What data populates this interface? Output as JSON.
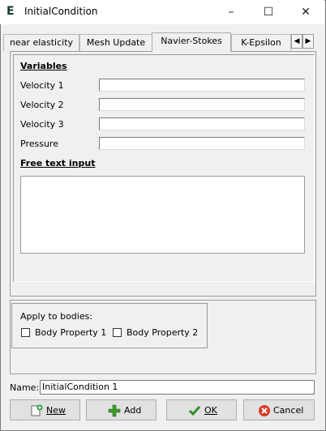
{
  "window": {
    "app_icon": "E",
    "title": "InitialCondition",
    "minimize": "–",
    "maximize": "☐",
    "close": "✕"
  },
  "tabs": [
    {
      "label": "near elasticity",
      "active": false
    },
    {
      "label": "Mesh Update",
      "active": false
    },
    {
      "label": "Navier-Stokes",
      "active": true
    },
    {
      "label": "K-Epsilon",
      "active": false
    }
  ],
  "tab_scroll": {
    "left": "◀",
    "right": "▶"
  },
  "variables": {
    "title": "Variables",
    "fields": [
      {
        "label": "Velocity 1",
        "value": ""
      },
      {
        "label": "Velocity 2",
        "value": ""
      },
      {
        "label": "Velocity 3",
        "value": ""
      },
      {
        "label": "Pressure",
        "value": ""
      }
    ]
  },
  "free_text": {
    "title": "Free text input",
    "value": ""
  },
  "bodies": {
    "label": "Apply to bodies:",
    "items": [
      {
        "label": "Body Property 1",
        "checked": false
      },
      {
        "label": "Body Property 2",
        "checked": false
      }
    ]
  },
  "name": {
    "label": "Name:",
    "value": "InitialCondition 1"
  },
  "buttons": {
    "new": {
      "label": "New",
      "icon": "new-document-icon"
    },
    "add": {
      "label": "Add",
      "icon": "plus-icon"
    },
    "ok": {
      "label": "OK",
      "icon": "checkmark-icon"
    },
    "cancel": {
      "label": "Cancel",
      "icon": "cancel-icon"
    }
  },
  "colors": {
    "plus": "#3c9a2d",
    "check": "#2f8f2a",
    "cancel": "#d93a2b",
    "new_badge": "#2d9a3a"
  }
}
